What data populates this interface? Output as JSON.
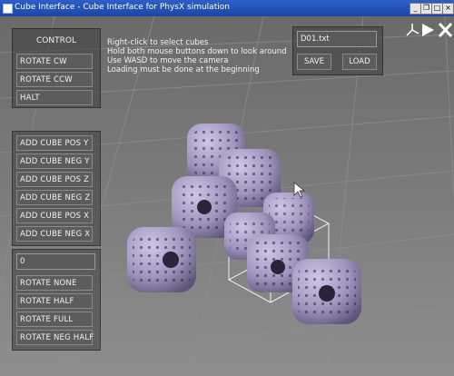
{
  "window": {
    "title": "Cube Interface - Cube Interface for PhysX simulation",
    "controls": [
      "minimize",
      "restore",
      "maximize",
      "close"
    ]
  },
  "control_panel": {
    "heading": "CONTROL",
    "buttons": [
      "ROTATE CW",
      "ROTATE CCW",
      "HALT"
    ]
  },
  "add_panel": {
    "buttons": [
      "ADD CUBE POS Y",
      "ADD CUBE NEG Y",
      "ADD CUBE POS Z",
      "ADD CUBE NEG Z",
      "ADD CUBE POS X",
      "ADD CUBE NEG X"
    ]
  },
  "rotate_panel": {
    "value": "0",
    "buttons": [
      "ROTATE NONE",
      "ROTATE HALF",
      "ROTATE FULL",
      "ROTATE NEG HALF"
    ]
  },
  "help": {
    "lines": [
      "Right-click to select cubes",
      "Hold both mouse buttons down to look around",
      "Use WASD to move the camera",
      "Loading must be done at the beginning"
    ]
  },
  "file_panel": {
    "filename": "D01.txt",
    "save_label": "SAVE",
    "load_label": "LOAD"
  },
  "icons": {
    "axes": "axes-icon",
    "play": "play-icon",
    "close": "close-x-icon"
  },
  "colors": {
    "titlebar": "#1f4bb0",
    "cube": "#a89cc4",
    "floor": "#7a7a7a"
  }
}
